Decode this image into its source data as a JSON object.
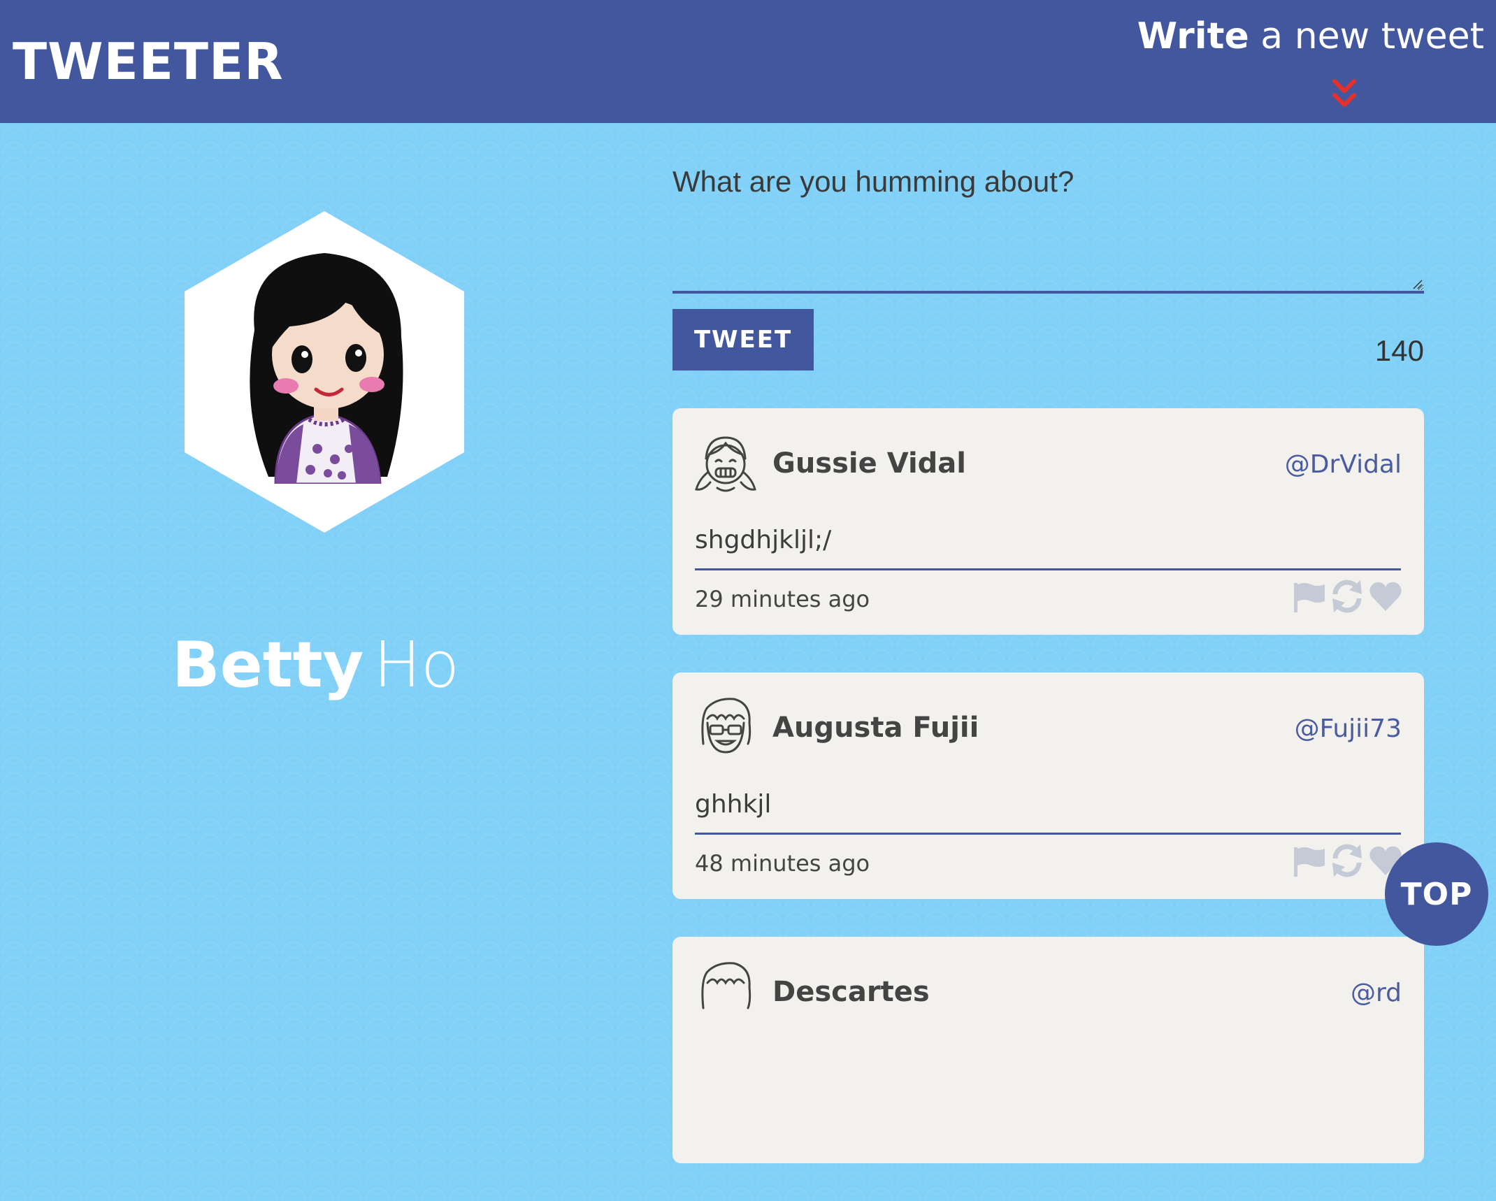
{
  "app": {
    "brand": "TWEETER"
  },
  "header": {
    "compose_toggle": {
      "bold": "Write",
      "rest": "a new tweet"
    },
    "accent_color": "#e8302a",
    "bar_color": "#43579e"
  },
  "profile": {
    "first_name": "Betty",
    "last_name": "Ho"
  },
  "compose": {
    "placeholder": "What are you humming about?",
    "button_label": "TWEET",
    "counter": "140"
  },
  "tweets": [
    {
      "avatar": "girl-braces-avatar-icon",
      "name": "Gussie Vidal",
      "handle": "@DrVidal",
      "text": "shgdhjkljl;/",
      "time": "29 minutes ago",
      "actions": [
        "flag-icon",
        "retweet-icon",
        "heart-icon"
      ]
    },
    {
      "avatar": "girl-sunglasses-avatar-icon",
      "name": "Augusta Fujii",
      "handle": "@Fujii73",
      "text": "ghhkjl",
      "time": "48 minutes ago",
      "actions": [
        "flag-icon",
        "retweet-icon",
        "heart-icon"
      ]
    },
    {
      "avatar": "girl-avatar-icon",
      "name": "Descartes",
      "handle": "@rd",
      "text": "",
      "time": "",
      "actions": []
    }
  ],
  "back_to_top": "TOP"
}
